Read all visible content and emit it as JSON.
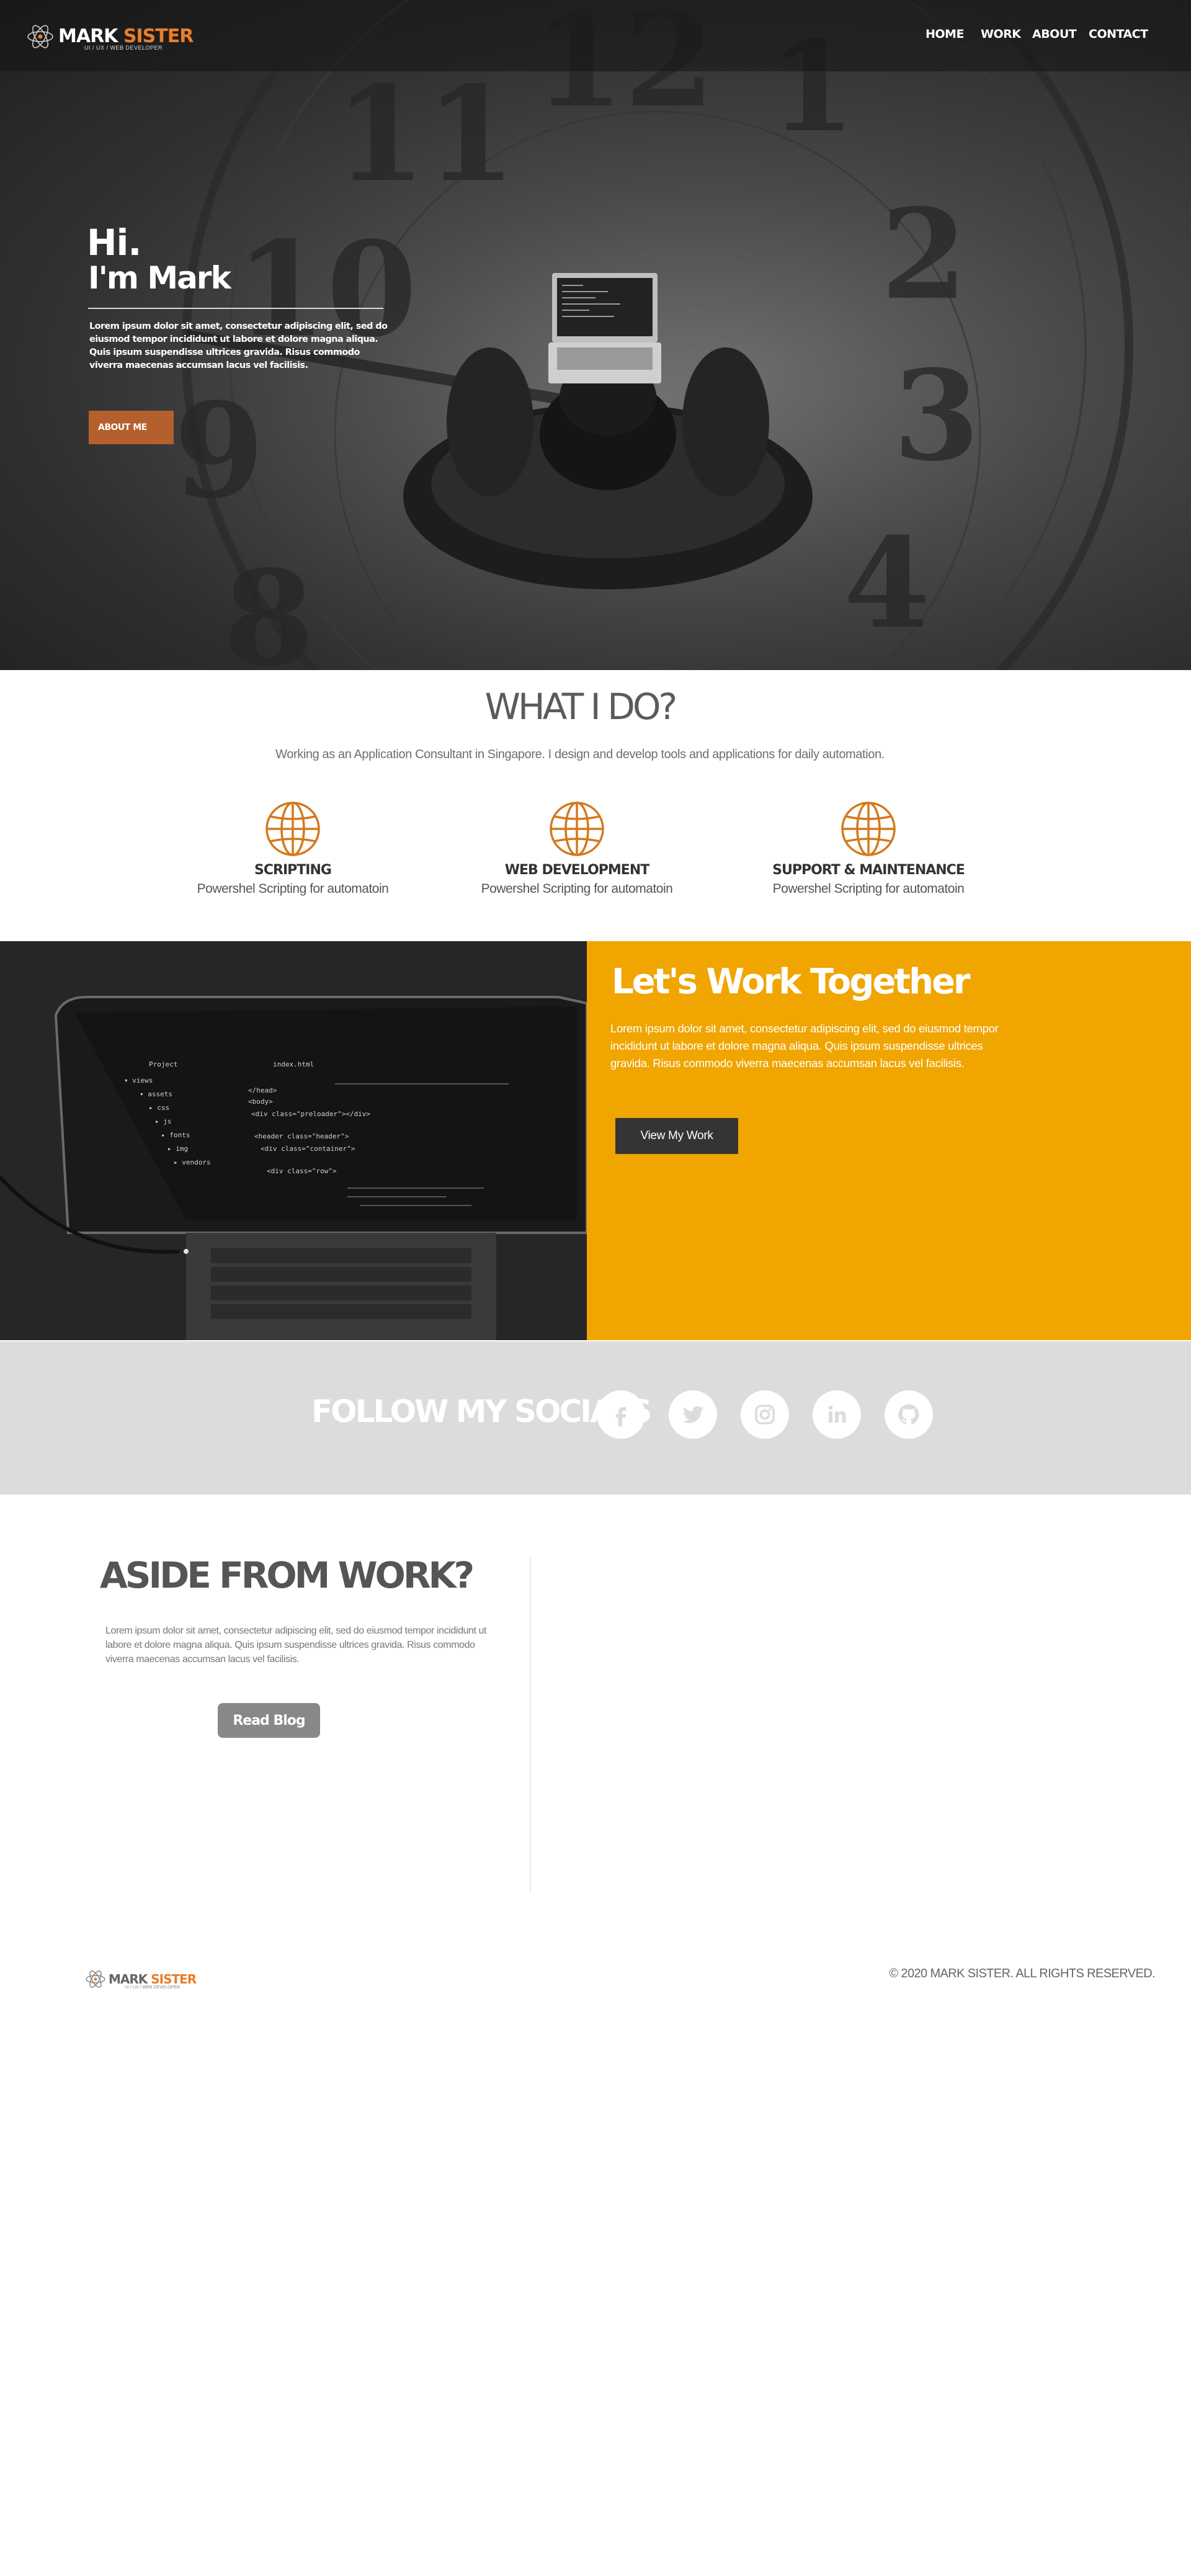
{
  "brand": {
    "name_part1": "MARK",
    "name_part2": "SISTER",
    "tagline": "UI / UX / WEB DEVELOPER",
    "accent_color": "#e87e2b"
  },
  "nav": {
    "items": [
      {
        "label": "HOME"
      },
      {
        "label": "WORK"
      },
      {
        "label": "ABOUT"
      },
      {
        "label": "CONTACT"
      }
    ]
  },
  "hero": {
    "greeting": "Hi.",
    "name_line": "I'm Mark",
    "body": "Lorem ipsum dolor sit amet, consectetur adipiscing elit, sed do eiusmod tempor incididunt ut labore et dolore magna aliqua. Quis ipsum suspendisse ultrices gravida. Risus commodo viverra maecenas accumsan lacus vel facilisis.",
    "button_label": "ABOUT ME",
    "button_color": "#b5602c"
  },
  "what_i_do": {
    "title": "WHAT I DO?",
    "subtitle": "Working as an Application Consultant in Singapore. I design and develop tools and applications for daily automation.",
    "services": [
      {
        "title": "SCRIPTING",
        "description": "Powershel Scripting for automatoin",
        "icon": "globe-icon"
      },
      {
        "title": "WEB DEVELOPMENT",
        "description": "Powershel Scripting for automatoin",
        "icon": "globe-icon"
      },
      {
        "title": "SUPPORT & MAINTENANCE",
        "description": "Powershel Scripting for automatoin",
        "icon": "globe-icon"
      }
    ]
  },
  "work_together": {
    "title": "Let's Work Together",
    "body": "Lorem ipsum dolor sit amet, consectetur adipiscing elit, sed do eiusmod tempor incididunt ut labore et dolore magna aliqua. Quis ipsum suspendisse ultrices gravida. Risus commodo viverra maecenas accumsan lacus vel facilisis.",
    "button_label": "View My Work",
    "panel_color": "#f0a500"
  },
  "socials": {
    "title": "FOLLOW MY SOCIALS",
    "icons": [
      "facebook-icon",
      "twitter-icon",
      "instagram-icon",
      "linkedin-icon",
      "github-icon"
    ]
  },
  "aside": {
    "title": "ASIDE FROM WORK?",
    "body": "Lorem ipsum dolor sit amet, consectetur adipiscing elit, sed do eiusmod tempor incididunt ut labore et dolore magna aliqua. Quis ipsum suspendisse ultrices gravida. Risus commodo viverra maecenas accumsan lacus vel facilisis.",
    "button_label": "Read Blog"
  },
  "footer": {
    "copyright": "© 2020 MARK SISTER. ALL RIGHTS RESERVED."
  }
}
